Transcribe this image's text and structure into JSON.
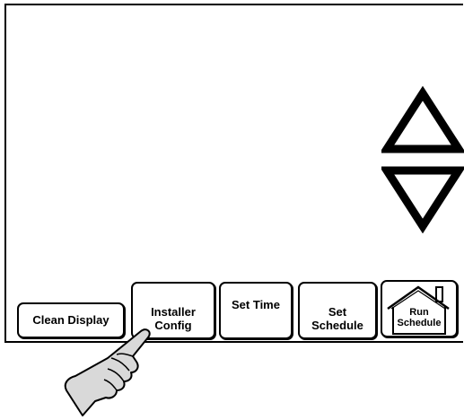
{
  "panel": {
    "buttons": {
      "clean_display": "Clean Display",
      "installer_config": [
        "Installer",
        "Config"
      ],
      "set_time": "Set Time",
      "set_schedule": [
        "Set",
        "Schedule"
      ],
      "run_schedule": [
        "Run",
        "Schedule"
      ]
    },
    "icons": {
      "up": "up-arrow-icon",
      "down": "down-arrow-icon",
      "house": "house-icon",
      "pointer": "pointing-hand-icon"
    }
  }
}
